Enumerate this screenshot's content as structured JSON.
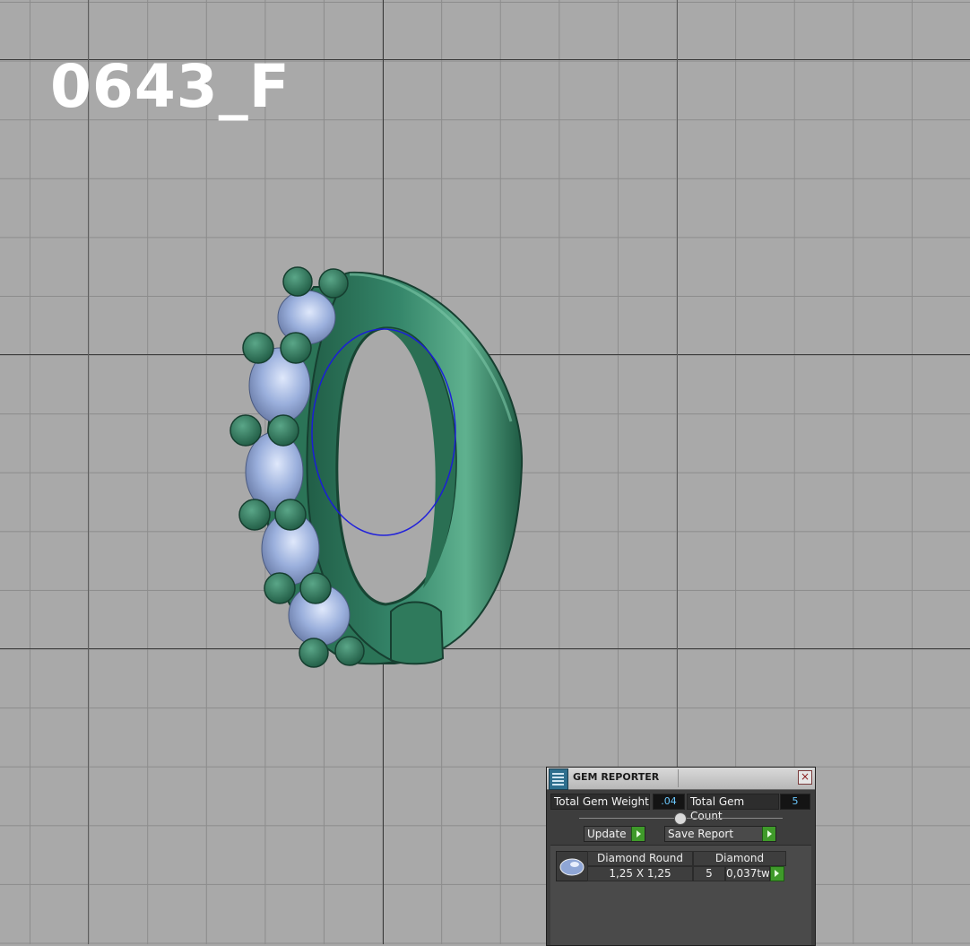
{
  "viewport": {
    "model_label": "0643_F"
  },
  "gem_reporter": {
    "title": "GEM REPORTER",
    "close_symbol": "×",
    "total_weight_label": "Total Gem Weight",
    "total_weight_value": ".04",
    "total_count_label": "Total Gem Count",
    "total_count_value": "5",
    "update_label": "Update",
    "save_report_label": "Save Report",
    "gems": [
      {
        "shape": "Diamond Round",
        "material": "Diamond",
        "size": "1,25 X 1,25",
        "count": "5",
        "weight": "0,037tw"
      }
    ]
  },
  "colors": {
    "metal": "#2f7a5c",
    "gem": "#8fa6d6",
    "grid_background": "#a9a9a9",
    "accent_green": "#3f9a2a",
    "value_text": "#6bc9ff"
  }
}
